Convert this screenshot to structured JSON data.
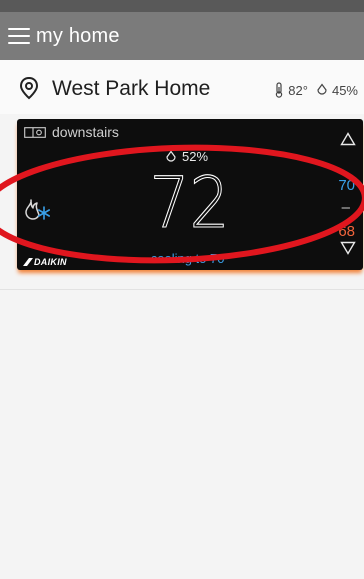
{
  "app": {
    "title": "my home"
  },
  "location": {
    "name": "West Park Home",
    "outdoor_temp": "82°",
    "outdoor_humidity": "45%"
  },
  "thermostat": {
    "zone_name": "downstairs",
    "indoor_humidity": "52%",
    "current_temp": "72",
    "status": "cooling to 70º",
    "cool_setpoint": "70",
    "setpoint_separator": "–",
    "heat_setpoint": "68",
    "brand": "DAIKIN",
    "mode": "auto-heat-cool"
  },
  "colors": {
    "app_bar": "#7b7b7b",
    "card_bg": "#0d0d0d",
    "cool_blue": "#3aa0e8",
    "heat_orange": "#f0643c",
    "card_glow": "#f2833a",
    "annotation_red": "#e0161e"
  }
}
